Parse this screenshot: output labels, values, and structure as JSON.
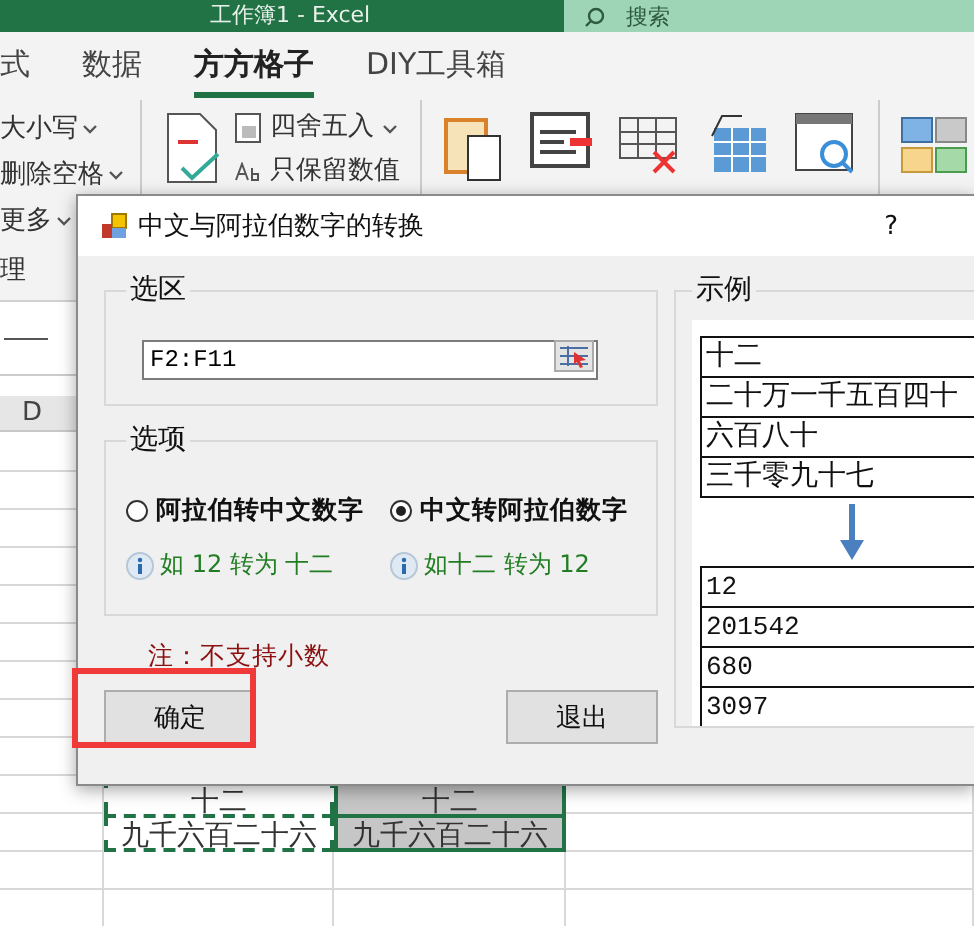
{
  "excel": {
    "title": "工作簿1 - Excel",
    "search_placeholder": "搜索",
    "tabs": [
      {
        "label": "式",
        "selected": false
      },
      {
        "label": "数据",
        "selected": false
      },
      {
        "label": "方方格子",
        "selected": true
      },
      {
        "label": "DIY工具箱",
        "selected": false
      }
    ],
    "ribbon_left": [
      {
        "label": "大小写",
        "dropdown": true
      },
      {
        "label": "删除空格",
        "dropdown": true
      },
      {
        "label": "更多",
        "dropdown": true
      }
    ],
    "ribbon_items": [
      {
        "label": "四舍五入",
        "dropdown": true
      },
      {
        "label": "只保留数值",
        "dropdown": false
      }
    ],
    "group_label": "理",
    "column_header": "D",
    "cell_rows": [
      [
        {
          "text": "十二",
          "selected": false
        },
        {
          "text": "十二",
          "selected": true
        }
      ],
      [
        {
          "text": "九千六百二十六",
          "selected": false
        },
        {
          "text": "九千六百二十六",
          "selected": true
        }
      ]
    ]
  },
  "dialog": {
    "title": "中文与阿拉伯数字的转换",
    "help": "?",
    "selection": {
      "label": "选区",
      "value": "F2:F11"
    },
    "options": {
      "label": "选项",
      "radios": [
        {
          "label": "阿拉伯转中文数字",
          "selected": false,
          "hint": "如 12 转为 十二"
        },
        {
          "label": "中文转阿拉伯数字",
          "selected": true,
          "hint": "如十二 转为 12"
        }
      ]
    },
    "note": "注：不支持小数",
    "buttons": [
      {
        "label": "确定",
        "highlighted": true
      },
      {
        "label": "退出",
        "highlighted": false
      }
    ],
    "example": {
      "label": "示例",
      "source": [
        "十二",
        "二十万一千五百四十",
        "六百八十",
        "三千零九十七"
      ],
      "result": [
        "12",
        "201542",
        "680",
        "3097"
      ]
    }
  }
}
